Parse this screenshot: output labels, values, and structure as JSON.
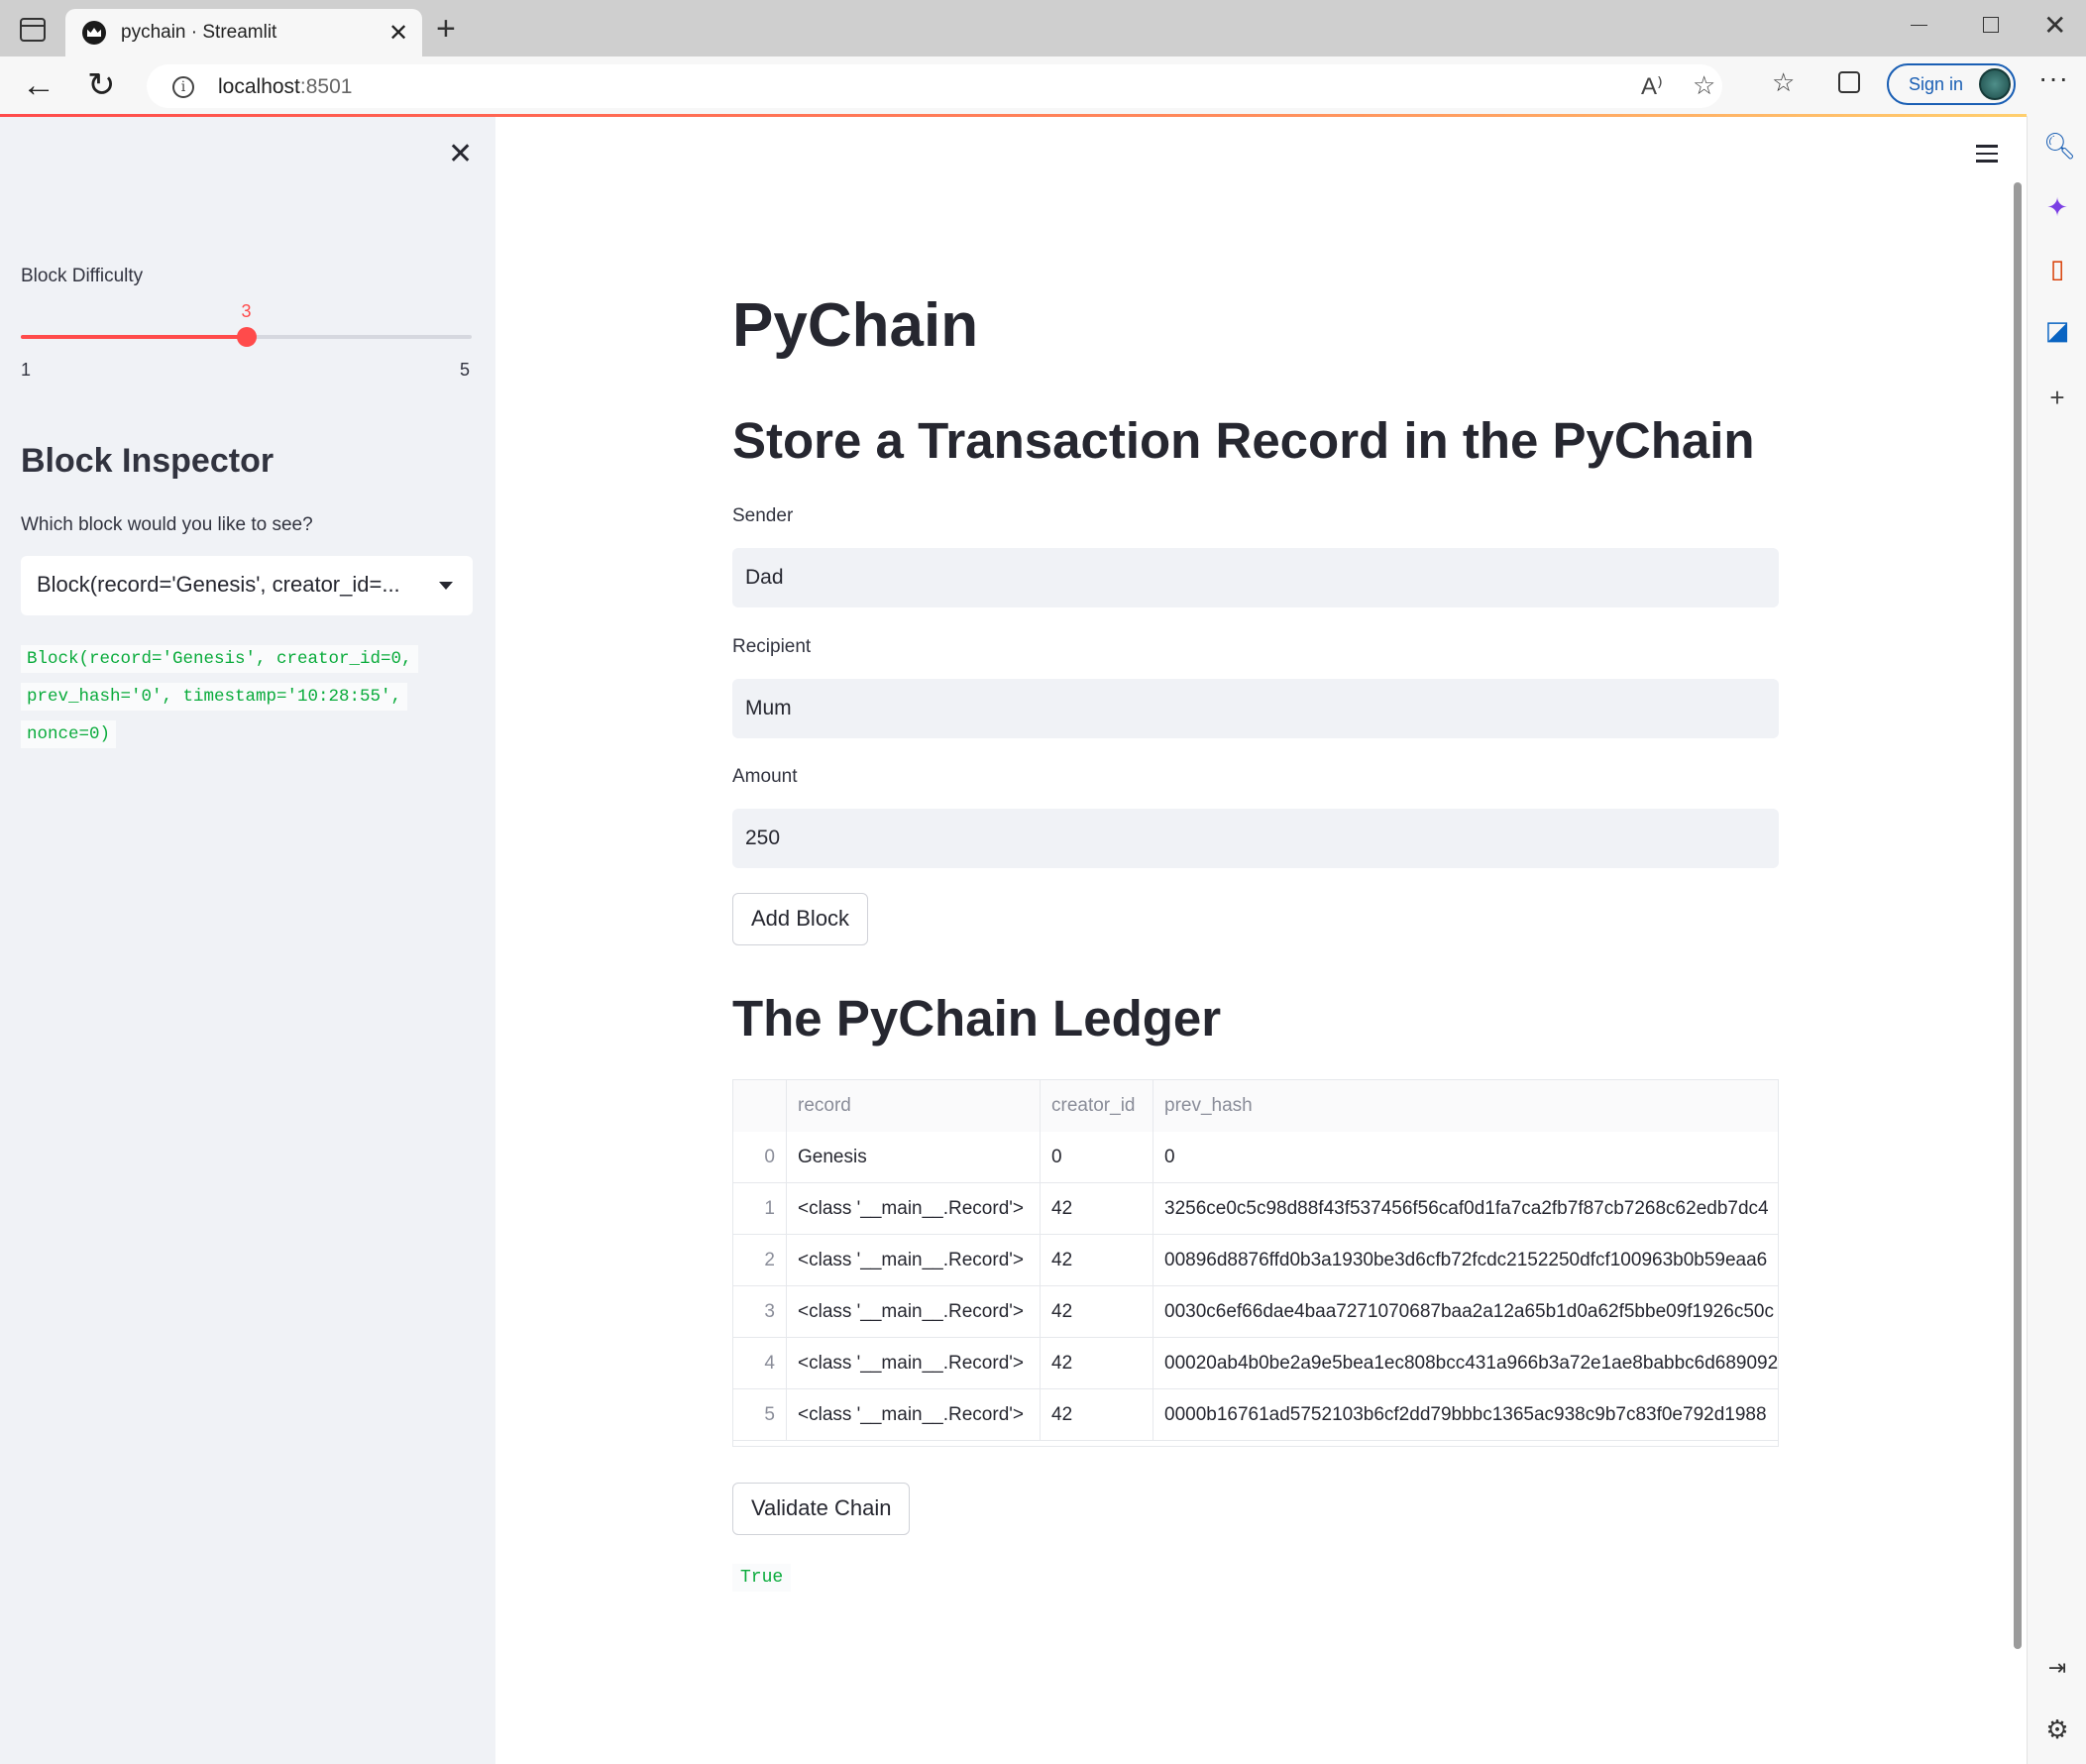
{
  "browser": {
    "tab_title": "pychain · Streamlit",
    "url_host": "localhost",
    "url_port": ":8501",
    "signin_label": "Sign in"
  },
  "sidebar": {
    "slider": {
      "label": "Block Difficulty",
      "value": "3",
      "min": "1",
      "max": "5",
      "value_fraction": 0.5
    },
    "heading": "Block Inspector",
    "select_label": "Which block would you like to see?",
    "select_value": "Block(record='Genesis', creator_id=...",
    "code_lines": [
      "Block(record='Genesis', creator_id=0,",
      "prev_hash='0', timestamp='10:28:55',",
      "nonce=0)"
    ]
  },
  "main": {
    "title": "PyChain",
    "form_heading": "Store a Transaction Record in the PyChain",
    "fields": {
      "sender_label": "Sender",
      "sender_value": "Dad",
      "recipient_label": "Recipient",
      "recipient_value": "Mum",
      "amount_label": "Amount",
      "amount_value": "250"
    },
    "add_button": "Add Block",
    "ledger_heading": "The PyChain Ledger",
    "table": {
      "columns": [
        "",
        "record",
        "creator_id",
        "prev_hash"
      ],
      "rows": [
        [
          "0",
          "Genesis",
          "0",
          "0"
        ],
        [
          "1",
          "<class '__main__.Record'>",
          "42",
          "3256ce0c5c98d88f43f537456f56caf0d1fa7ca2fb7f87cb7268c62edb7dc4"
        ],
        [
          "2",
          "<class '__main__.Record'>",
          "42",
          "00896d8876ffd0b3a1930be3d6cfb72fcdc2152250dfcf100963b0b59eaa6"
        ],
        [
          "3",
          "<class '__main__.Record'>",
          "42",
          "0030c6ef66dae4baa7271070687baa2a12a65b1d0a62f5bbe09f1926c50c"
        ],
        [
          "4",
          "<class '__main__.Record'>",
          "42",
          "00020ab4b0be2a9e5bea1ec808bcc431a966b3a72e1ae8babbc6d689092"
        ],
        [
          "5",
          "<class '__main__.Record'>",
          "42",
          "0000b16761ad5752103b6cf2dd79bbbc1365ac938c9b7c83f0e792d1988"
        ]
      ]
    },
    "validate_button": "Validate Chain",
    "validate_result": "True"
  },
  "colors": {
    "accent": "#ff4b4b",
    "code_green": "#09ab3b",
    "sidebar_bg": "#f0f2f6"
  }
}
